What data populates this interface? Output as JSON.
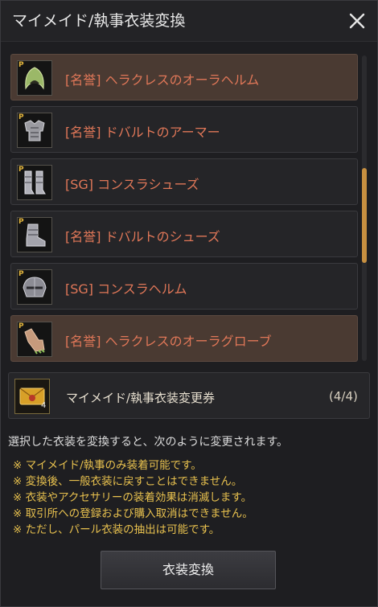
{
  "window": {
    "title": "マイメイド/執事衣装変換"
  },
  "items": [
    {
      "label": "[名誉] ヘラクレスのオーラヘルム",
      "badge": "P",
      "icon": "helm-icon",
      "selected": true
    },
    {
      "label": "[名誉] ドバルトのアーマー",
      "badge": "P",
      "icon": "armor-icon",
      "selected": false
    },
    {
      "label": "[SG] コンスラシューズ",
      "badge": "P",
      "icon": "boots-icon",
      "selected": false
    },
    {
      "label": "[名誉] ドバルトのシューズ",
      "badge": "P",
      "icon": "boot-icon",
      "selected": false
    },
    {
      "label": "[SG] コンスラヘルム",
      "badge": "P",
      "icon": "helmet-icon",
      "selected": false
    },
    {
      "label": "[名誉] ヘラクレスのオーラグローブ",
      "badge": "P",
      "icon": "glove-icon",
      "selected": true
    }
  ],
  "ticket": {
    "name": "マイメイド/執事衣装変更券",
    "stack": "4",
    "quantity": "(4/4)",
    "icon": "ticket-icon"
  },
  "description": "選択した衣装を変換すると、次のように変更されます。",
  "notes": [
    "※ マイメイド/執事のみ装着可能です。",
    "※ 変換後、一般衣装に戻すことはできません。",
    "※ 衣装やアクセサリーの装着効果は消滅します。",
    "※ 取引所への登録および購入取消はできません。",
    "※ ただし、パール衣装の抽出は可能です。"
  ],
  "button": {
    "label": "衣装変換"
  },
  "colors": {
    "item_text": "#e07758",
    "note_text": "#e7c04e",
    "selected_bg": "#4a3a32",
    "scroll_thumb": "#c89040"
  }
}
